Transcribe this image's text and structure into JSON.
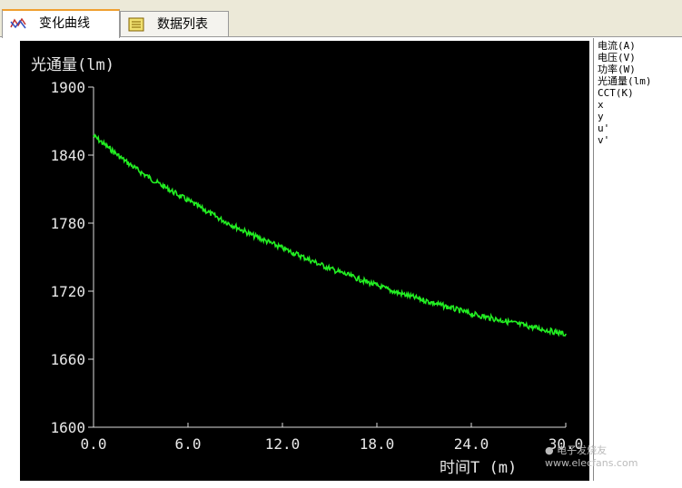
{
  "tabs": [
    {
      "label": "变化曲线",
      "icon": "curve-chart-icon",
      "active": true
    },
    {
      "label": "数据列表",
      "icon": "list-icon",
      "active": false
    }
  ],
  "legend_items": [
    "电流(A)",
    "电压(V)",
    "功率(W)",
    "光通量(lm)",
    "CCT(K)",
    "x",
    "y",
    "u'",
    "v'"
  ],
  "watermark": "电子发烧友 www.elecfans.com",
  "chart_data": {
    "type": "line",
    "title": "",
    "ylabel": "光通量(lm)",
    "xlabel": "时间T  (m)",
    "xlim": [
      0,
      30
    ],
    "ylim": [
      1600,
      1900
    ],
    "xticks": [
      "0.0",
      "6.0",
      "12.0",
      "18.0",
      "24.0",
      "30.0"
    ],
    "yticks": [
      "1600",
      "1660",
      "1720",
      "1780",
      "1840",
      "1900"
    ],
    "grid": false,
    "series": [
      {
        "color": "#22ee22",
        "x": [
          0,
          1,
          2,
          3,
          4,
          5,
          6,
          7,
          8,
          9,
          10,
          11,
          12,
          13,
          14,
          15,
          16,
          17,
          18,
          19,
          20,
          21,
          22,
          23,
          24,
          25,
          26,
          27,
          28,
          29,
          30
        ],
        "y": [
          1857,
          1846,
          1835,
          1825,
          1816,
          1808,
          1800,
          1792,
          1784,
          1777,
          1770,
          1764,
          1758,
          1752,
          1746,
          1740,
          1735,
          1730,
          1725,
          1720,
          1716,
          1712,
          1708,
          1704,
          1700,
          1697,
          1694,
          1691,
          1688,
          1685,
          1682
        ]
      }
    ]
  }
}
